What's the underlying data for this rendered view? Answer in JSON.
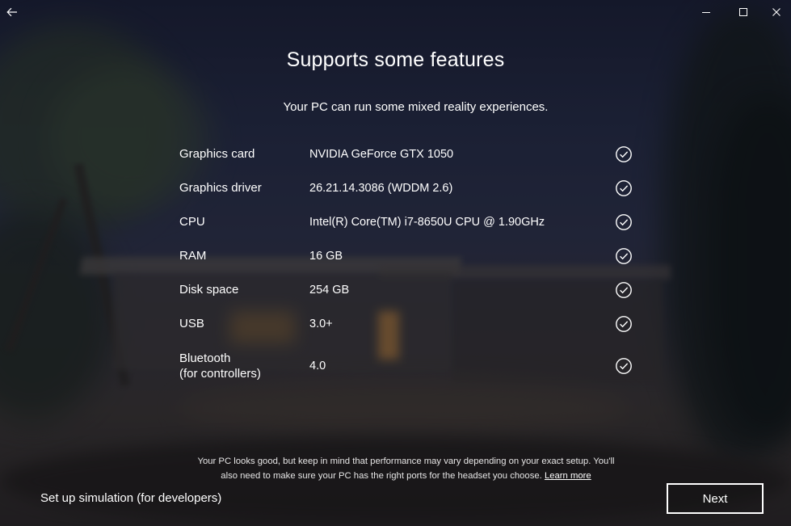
{
  "titlebar": {
    "back_icon": "arrow-left-icon",
    "minimize_icon": "minimize-icon",
    "maximize_icon": "maximize-icon",
    "close_icon": "close-icon"
  },
  "main": {
    "title": "Supports some features",
    "subtitle": "Your PC can run some mixed reality experiences.",
    "requirements": [
      {
        "label": "Graphics card",
        "value": "NVIDIA GeForce GTX 1050",
        "status_icon": "check-circle-icon"
      },
      {
        "label": "Graphics driver",
        "value": "26.21.14.3086 (WDDM 2.6)",
        "status_icon": "check-circle-icon"
      },
      {
        "label": "CPU",
        "value": "Intel(R) Core(TM) i7-8650U CPU @ 1.90GHz",
        "status_icon": "check-circle-icon"
      },
      {
        "label": "RAM",
        "value": "16 GB",
        "status_icon": "check-circle-icon"
      },
      {
        "label": "Disk space",
        "value": "254 GB",
        "status_icon": "check-circle-icon"
      },
      {
        "label": "USB",
        "value": "3.0+",
        "status_icon": "check-circle-icon"
      },
      {
        "label": "Bluetooth",
        "label_line2": "(for controllers)",
        "value": "4.0",
        "status_icon": "check-circle-icon"
      }
    ],
    "footnote_line1": "Your PC looks good, but keep in mind that performance may vary depending on your exact setup. You'll",
    "footnote_line2": "also need to make sure your PC has the right ports for the headset you choose.",
    "footnote_link": "Learn more"
  },
  "footer": {
    "simulation_link": "Set up simulation (for developers)",
    "next_button": "Next"
  }
}
